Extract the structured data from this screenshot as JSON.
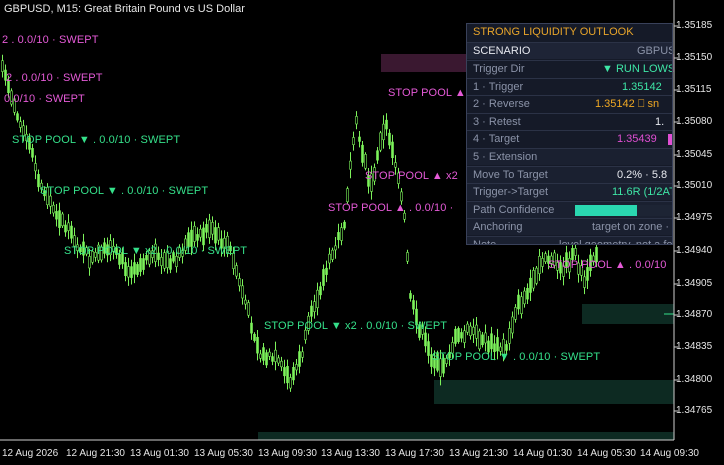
{
  "chart": {
    "title": "GBPUSD, M15:  Great Britain Pound vs US Dollar",
    "price_axis": [
      "1.35185",
      "1.35150",
      "1.35115",
      "1.35080",
      "1.35045",
      "1.35010",
      "1.34975",
      "1.34940",
      "1.34905",
      "1.34870",
      "1.34835",
      "1.34800",
      "1.34765"
    ],
    "time_axis": [
      "12 Aug 2026",
      "12 Aug 21:30",
      "13 Aug 01:30",
      "13 Aug 05:30",
      "13 Aug 09:30",
      "13 Aug 13:30",
      "13 Aug 17:30",
      "13 Aug 21:30",
      "14 Aug 01:30",
      "14 Aug 05:30",
      "14 Aug 09:30"
    ],
    "colors": {
      "bull": "#7cf25a",
      "bear": "#7cf25a",
      "pink": "#e55ad7",
      "green": "#35e08a",
      "zone_green": "#0d2a22",
      "zone_pink": "#3a1830"
    }
  },
  "annotations": [
    {
      "text": "2 . 0.0/10  ·  SWEPT",
      "color": "pink"
    },
    {
      "text": "2 . 0.0/10  ·  SWEPT",
      "color": "pink"
    },
    {
      "text": "0.0/10  ·  SWEPT",
      "color": "pink"
    },
    {
      "text": "STOP POOL ▼   . 0.0/10  ·  SWEPT",
      "color": "green"
    },
    {
      "text": "STOP POOL ▼   . 0.0/10  ·  SWEPT",
      "color": "green"
    },
    {
      "text": "STOP POOL ▼ x2  . 0.0/10  ·  SWEPT",
      "color": "green"
    },
    {
      "text": "STOP POOL ▲",
      "color": "pink"
    },
    {
      "text": "STOP POOL ▲ x2",
      "color": "pink"
    },
    {
      "text": "STOP POOL ▲   . 0.0/10  ·",
      "color": "pink"
    },
    {
      "text": "STOP POOL ▼ x2  . 0.0/10  ·  SWEPT",
      "color": "green"
    },
    {
      "text": "STOP POOL ▼   . 0.0/10  ·  SWEPT",
      "color": "green"
    },
    {
      "text": "STOP POOL ▲   . 0.0/10",
      "color": "pink"
    }
  ],
  "panel": {
    "title": "STRONG LIQUIDITY OUTLOOK",
    "scenario_label": "SCENARIO",
    "scenario_value": "GBPUSD",
    "rows": [
      {
        "label": "Trigger Dir",
        "value": "▼ RUN LOWS"
      },
      {
        "label": "1 · Trigger",
        "value": "1.35142"
      },
      {
        "label": "2 · Reverse",
        "value": "1.35142  ⎕ sn"
      },
      {
        "label": "3 · Retest",
        "value": "1."
      },
      {
        "label": "4 · Target",
        "value": "1.35439"
      },
      {
        "label": "5 · Extension",
        "value": ""
      },
      {
        "label": "Move To Target",
        "value": "0.2%  ·  5.8"
      },
      {
        "label": "Trigger->Target",
        "value": "11.6R  (1/2AT"
      },
      {
        "label": "Path Confidence",
        "value": ""
      },
      {
        "label": "Anchoring",
        "value": "target on zone  ·"
      },
      {
        "label": "Note",
        "value": "level geometry, not a fo"
      }
    ]
  }
}
